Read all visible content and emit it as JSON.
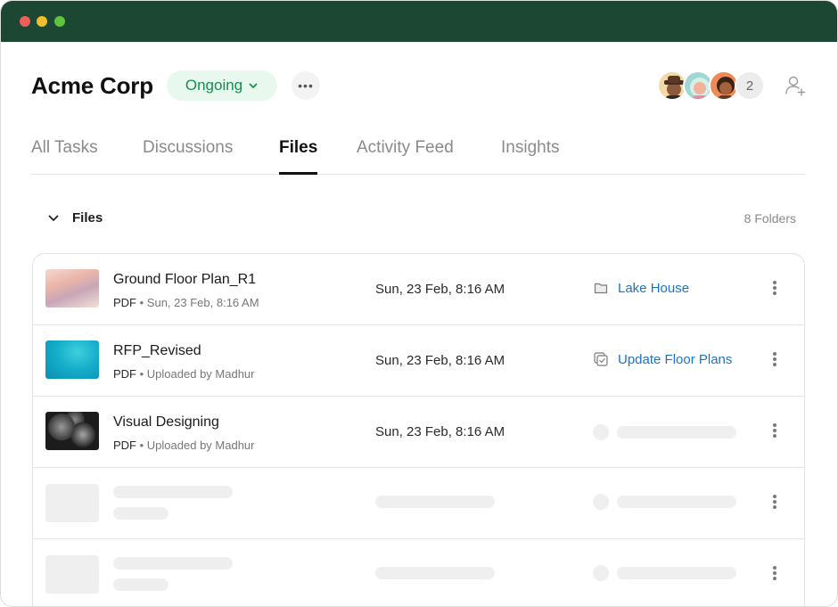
{
  "header": {
    "title": "Acme Corp",
    "status": "Ongoing",
    "more": "•••",
    "member_overflow": "2"
  },
  "tabs": [
    {
      "label": "All Tasks",
      "active": false
    },
    {
      "label": "Discussions",
      "active": false
    },
    {
      "label": "Files",
      "active": true
    },
    {
      "label": "Activity Feed",
      "active": false
    },
    {
      "label": "Insights",
      "active": false
    }
  ],
  "section": {
    "title": "Files",
    "folder_count": "8 Folders"
  },
  "files": [
    {
      "name": "Ground Floor Plan_R1",
      "type": "PDF",
      "meta": "Sun, 23 Feb, 8:16 AM",
      "date": "Sun, 23 Feb, 8:16 AM",
      "folder": "Lake House",
      "folder_icon": "folder-icon"
    },
    {
      "name": "RFP_Revised",
      "type": "PDF",
      "meta": "Uploaded by Madhur",
      "date": "Sun, 23 Feb, 8:16 AM",
      "folder": "Update Floor Plans",
      "folder_icon": "task-stack-icon"
    },
    {
      "name": "Visual Designing",
      "type": "PDF",
      "meta": "Uploaded by Madhur",
      "date": "Sun, 23 Feb, 8:16 AM"
    }
  ],
  "colors": {
    "titlebar": "#1b4733",
    "status_bg": "#e9f8ef",
    "status_text": "#14904d",
    "link": "#1a73c9"
  }
}
